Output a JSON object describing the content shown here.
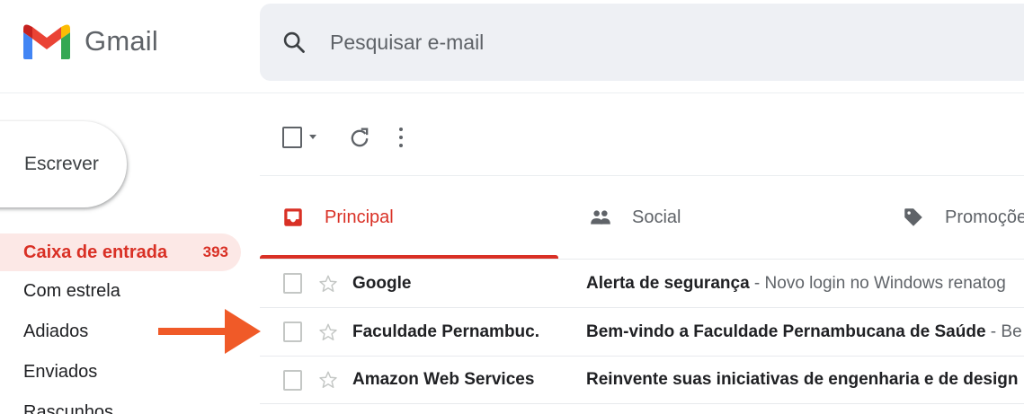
{
  "app": {
    "logo_text": "Gmail"
  },
  "search": {
    "placeholder": "Pesquisar e-mail"
  },
  "compose": {
    "label": "Escrever"
  },
  "sidebar": {
    "items": [
      {
        "label": "Caixa de entrada",
        "count": "393",
        "active": true
      },
      {
        "label": "Com estrela"
      },
      {
        "label": "Adiados"
      },
      {
        "label": "Enviados"
      },
      {
        "label": "Rascunhos"
      }
    ]
  },
  "tabs": [
    {
      "label": "Principal",
      "icon": "inbox-icon",
      "active": true
    },
    {
      "label": "Social",
      "icon": "people-icon"
    },
    {
      "label": "Promoções",
      "icon": "tag-icon"
    }
  ],
  "emails": [
    {
      "sender": "Google",
      "subject": "Alerta de segurança",
      "snippet": " - Novo login no Windows renatog"
    },
    {
      "sender": "Faculdade Pernambuc.",
      "subject": "Bem-vindo a Faculdade Pernambucana de Saúde",
      "snippet": " - Be"
    },
    {
      "sender": "Amazon Web Services",
      "subject": "Reinvente suas iniciativas de engenharia e de design",
      "snippet": ""
    }
  ],
  "colors": {
    "accent": "#d93025",
    "active_bg": "#fce8e6",
    "search_bg": "#eef0f4",
    "arrow": "#f05a28"
  }
}
